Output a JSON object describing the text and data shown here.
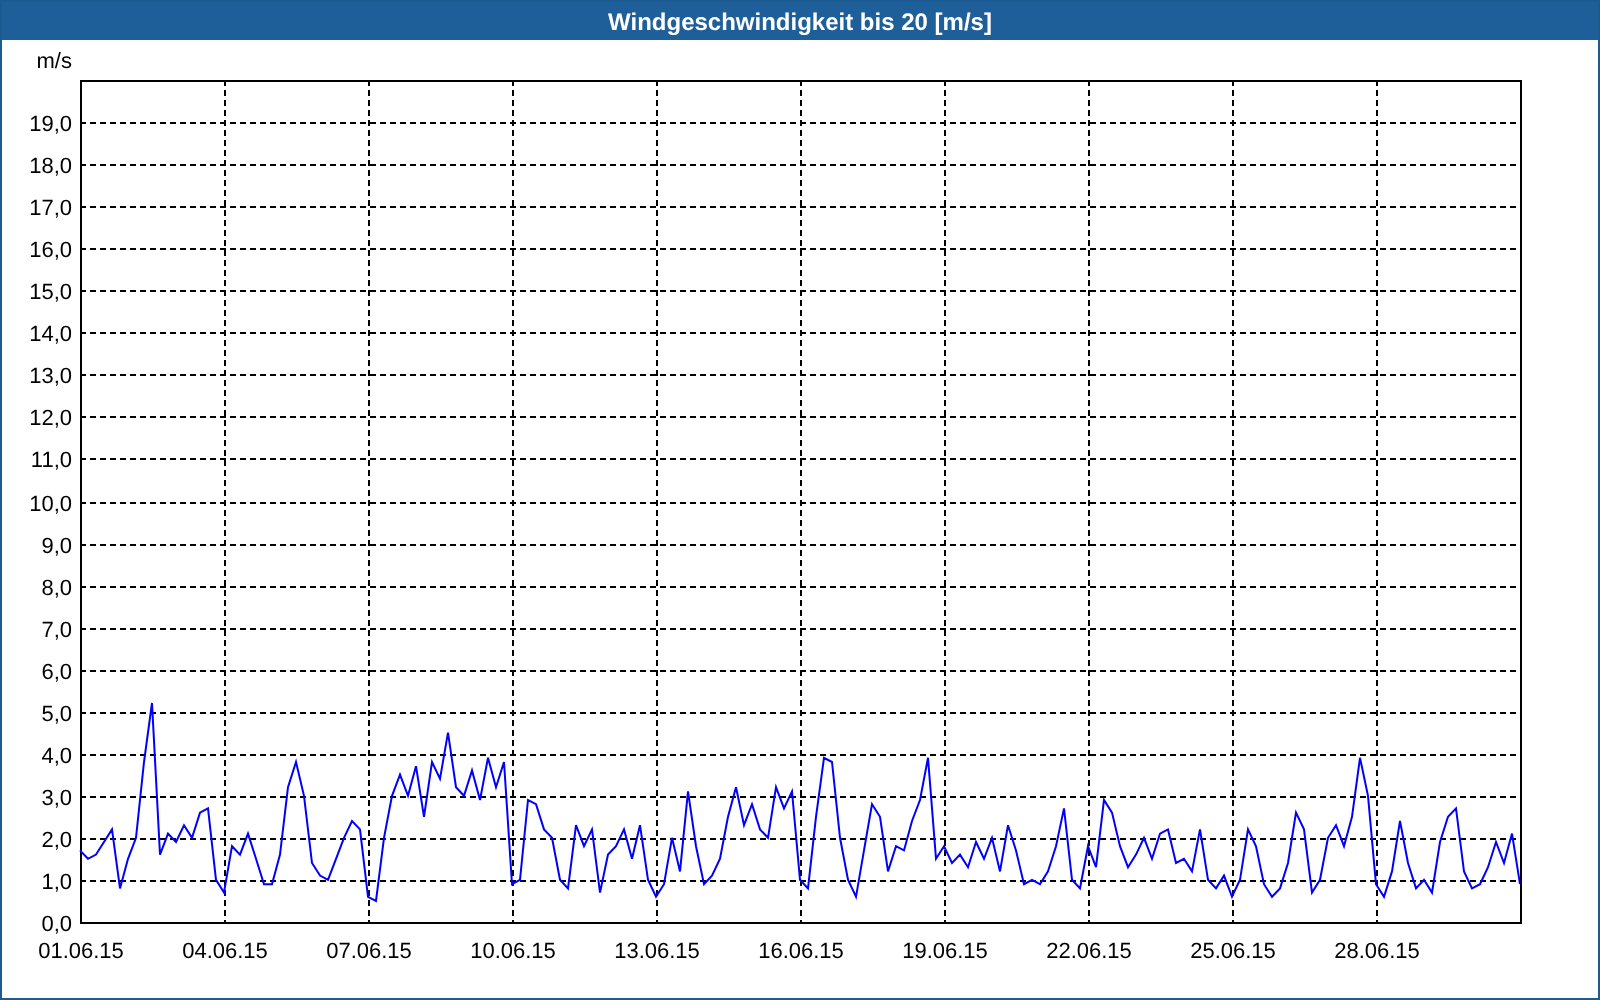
{
  "window": {
    "title": "Windgeschwindigkeit bis 20 [m/s]"
  },
  "chart": {
    "chart_data": {
      "type": "line",
      "grid": true,
      "ylabel": "m/s",
      "ylim": [
        0,
        20
      ],
      "categories": [
        "01.06.15",
        null,
        null,
        null,
        null,
        null,
        null,
        null,
        null,
        null,
        null,
        null,
        null,
        null,
        null,
        null,
        null,
        null,
        "04.06.15",
        null,
        null,
        null,
        null,
        null,
        null,
        null,
        null,
        null,
        null,
        null,
        null,
        null,
        null,
        null,
        null,
        null,
        "07.06.15",
        null,
        null,
        null,
        null,
        null,
        null,
        null,
        null,
        null,
        null,
        null,
        null,
        null,
        null,
        null,
        null,
        null,
        "10.06.15",
        null,
        null,
        null,
        null,
        null,
        null,
        null,
        null,
        null,
        null,
        null,
        null,
        null,
        null,
        null,
        null,
        null,
        "13.06.15",
        null,
        null,
        null,
        null,
        null,
        null,
        null,
        null,
        null,
        null,
        null,
        null,
        null,
        null,
        null,
        null,
        null,
        "16.06.15",
        null,
        null,
        null,
        null,
        null,
        null,
        null,
        null,
        null,
        null,
        null,
        null,
        null,
        null,
        null,
        null,
        null,
        "19.06.15",
        null,
        null,
        null,
        null,
        null,
        null,
        null,
        null,
        null,
        null,
        null,
        null,
        null,
        null,
        null,
        null,
        null,
        "22.06.15",
        null,
        null,
        null,
        null,
        null,
        null,
        null,
        null,
        null,
        null,
        null,
        null,
        null,
        null,
        null,
        null,
        null,
        "25.06.15",
        null,
        null,
        null,
        null,
        null,
        null,
        null,
        null,
        null,
        null,
        null,
        null,
        null,
        null,
        null,
        null,
        null,
        "28.06.15",
        null,
        null,
        null,
        null,
        null,
        null,
        null,
        null,
        null,
        null,
        null,
        null,
        null,
        null,
        null,
        null,
        null,
        null
      ],
      "yticks": [
        {
          "value": 0,
          "label": "0,0"
        },
        {
          "value": 1,
          "label": "1,0"
        },
        {
          "value": 2,
          "label": "2,0"
        },
        {
          "value": 3,
          "label": "3,0"
        },
        {
          "value": 4,
          "label": "4,0"
        },
        {
          "value": 5,
          "label": "5,0"
        },
        {
          "value": 6,
          "label": "6,0"
        },
        {
          "value": 7,
          "label": "7,0"
        },
        {
          "value": 8,
          "label": "8,0"
        },
        {
          "value": 9,
          "label": "9,0"
        },
        {
          "value": 10,
          "label": "10,0"
        },
        {
          "value": 11,
          "label": "11,0"
        },
        {
          "value": 12,
          "label": "12,0"
        },
        {
          "value": 13,
          "label": "13,0"
        },
        {
          "value": 14,
          "label": "14,0"
        },
        {
          "value": 15,
          "label": "15,0"
        },
        {
          "value": 16,
          "label": "16,0"
        },
        {
          "value": 17,
          "label": "17,0"
        },
        {
          "value": 18,
          "label": "18,0"
        },
        {
          "value": 19,
          "label": "19,0"
        }
      ],
      "series": [
        {
          "color": "#0000ff",
          "values": [
            1.7,
            1.5,
            1.6,
            1.9,
            2.2,
            0.8,
            1.5,
            2.0,
            3.8,
            5.2,
            1.6,
            2.1,
            1.9,
            2.3,
            2.0,
            2.6,
            2.7,
            1.0,
            0.7,
            1.8,
            1.6,
            2.1,
            1.5,
            0.9,
            0.9,
            1.6,
            3.2,
            3.8,
            3.0,
            1.4,
            1.1,
            1.0,
            1.5,
            2.0,
            2.4,
            2.2,
            0.6,
            0.5,
            2.0,
            3.0,
            3.5,
            3.0,
            3.7,
            2.5,
            3.8,
            3.4,
            4.5,
            3.2,
            3.0,
            3.6,
            2.9,
            3.9,
            3.2,
            3.8,
            0.9,
            1.0,
            2.9,
            2.8,
            2.2,
            2.0,
            1.0,
            0.8,
            2.3,
            1.8,
            2.2,
            0.7,
            1.6,
            1.8,
            2.2,
            1.5,
            2.3,
            1.0,
            0.6,
            0.9,
            2.0,
            1.2,
            3.1,
            1.8,
            0.9,
            1.1,
            1.5,
            2.5,
            3.2,
            2.3,
            2.8,
            2.2,
            2.0,
            3.2,
            2.7,
            3.1,
            1.0,
            0.8,
            2.5,
            3.9,
            3.8,
            2.0,
            1.0,
            0.6,
            1.7,
            2.8,
            2.5,
            1.2,
            1.8,
            1.7,
            2.4,
            2.9,
            3.9,
            1.5,
            1.8,
            1.4,
            1.6,
            1.3,
            1.9,
            1.5,
            2.0,
            1.2,
            2.3,
            1.7,
            0.9,
            1.0,
            0.9,
            1.2,
            1.8,
            2.7,
            1.0,
            0.8,
            1.8,
            1.3,
            2.9,
            2.6,
            1.8,
            1.3,
            1.6,
            2.0,
            1.5,
            2.1,
            2.2,
            1.4,
            1.5,
            1.2,
            2.2,
            1.0,
            0.8,
            1.1,
            0.6,
            1.0,
            2.2,
            1.8,
            0.9,
            0.6,
            0.8,
            1.4,
            2.6,
            2.2,
            0.7,
            1.0,
            2.0,
            2.3,
            1.8,
            2.5,
            3.9,
            3.0,
            0.9,
            0.6,
            1.2,
            2.4,
            1.4,
            0.8,
            1.0,
            0.7,
            1.9,
            2.5,
            2.7,
            1.2,
            0.8,
            0.9,
            1.3,
            1.9,
            1.4,
            2.1,
            0.9
          ]
        }
      ]
    }
  }
}
